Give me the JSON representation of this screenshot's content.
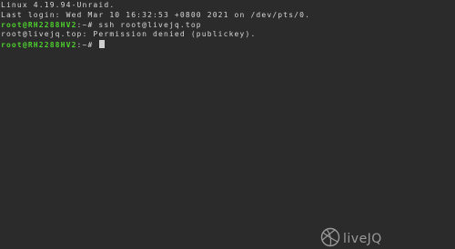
{
  "terminal": {
    "lines": [
      {
        "text": "Linux 4.19.94-Unraid."
      },
      {
        "text": "Last login: Wed Mar 10 16:32:53 +0800 2021 on /dev/pts/0."
      },
      {
        "user": "root@RH2288HV2",
        "path": ":~# ",
        "command": "ssh root@livejq.top"
      },
      {
        "text": "root@livejq.top: Permission denied (publickey)."
      },
      {
        "user": "root@RH2288HV2",
        "path": ":~# ",
        "command": ""
      }
    ]
  },
  "watermark": {
    "text": "liveJQ",
    "icon": "basketball-icon"
  },
  "colors": {
    "background": "#2b2b2b",
    "text": "#d8d8d8",
    "prompt_user": "#4ed12e",
    "watermark": "#9a9a9a"
  }
}
